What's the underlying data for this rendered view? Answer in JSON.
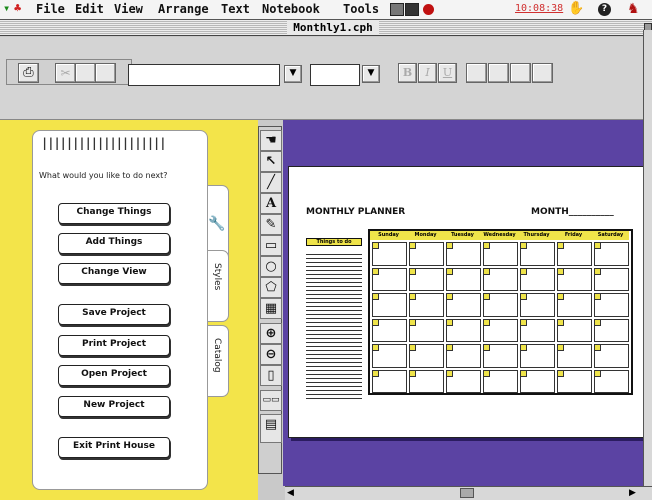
{
  "menubar": {
    "items": [
      "File",
      "Edit",
      "View",
      "Arrange",
      "Text",
      "Notebook",
      "Tools"
    ],
    "clock": "10:08:38"
  },
  "window": {
    "title": "Monthly1.cph"
  },
  "toolbar": {
    "style_buttons": [
      "B",
      "I",
      "U"
    ]
  },
  "panel": {
    "spiral": "||||||||||||||||||||",
    "prompt": "What would you like to do next?",
    "buttons": [
      "Change Things",
      "Add Things",
      "Change View",
      "Save Project",
      "Print Project",
      "Open Project",
      "New Project",
      "Exit Print House"
    ],
    "tabs": [
      "Styles",
      "Catalog"
    ]
  },
  "planner": {
    "title": "MONTHLY PLANNER",
    "month_label": "MONTH__________",
    "notes_header": "Things to do",
    "days": [
      "Sunday",
      "Monday",
      "Tuesday",
      "Wednesday",
      "Thursday",
      "Friday",
      "Saturday"
    ]
  },
  "colors": {
    "workspace_yellow": "#f3e44a",
    "page_purple": "#5b43a3"
  },
  "icons": [
    "apple-icon",
    "printer-icon",
    "cut-icon",
    "copy-icon",
    "paste-icon",
    "hand-icon",
    "arrow-icon",
    "text-tool-icon",
    "pencil-icon",
    "rectangle-icon",
    "oval-icon",
    "polygon-icon",
    "grid-icon",
    "zoom-in-icon",
    "zoom-out-icon",
    "page-icon",
    "help-icon"
  ]
}
